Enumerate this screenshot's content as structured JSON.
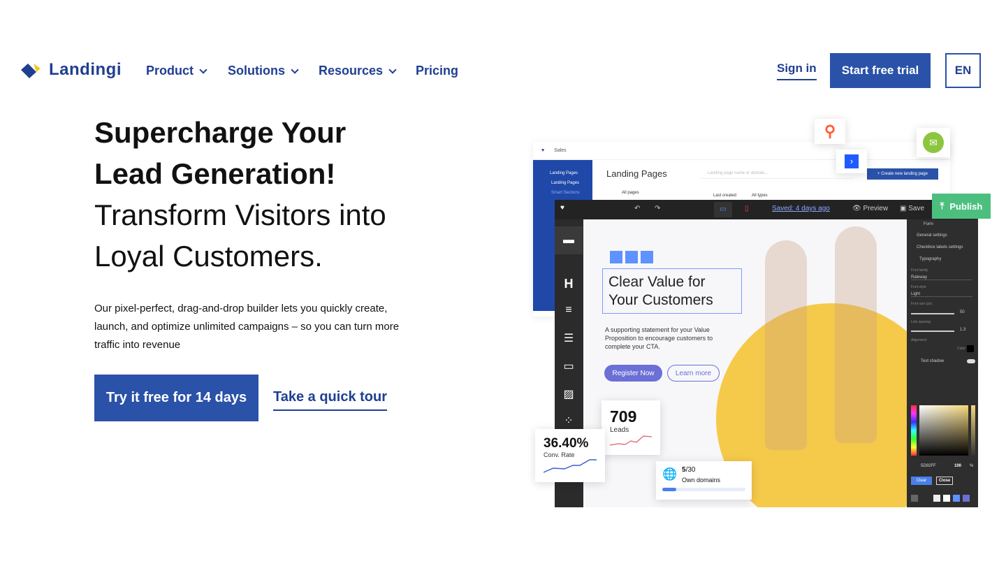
{
  "header": {
    "logo_text": "Landingi",
    "nav": [
      {
        "label": "Product"
      },
      {
        "label": "Solutions"
      },
      {
        "label": "Resources"
      },
      {
        "label": "Pricing"
      }
    ],
    "sign_in": "Sign in",
    "start_trial": "Start free trial",
    "language": "EN"
  },
  "hero": {
    "title_line1": "Supercharge Your",
    "title_line2": "Lead Generation!",
    "subtitle_line1": "Transform Visitors into",
    "subtitle_line2": "Loyal Customers.",
    "description": "Our pixel-perfect, drag-and-drop builder lets you quickly create, launch, and optimize unlimited campaigns – so you can turn more traffic into revenue",
    "cta_primary": "Try it free for 14 days",
    "cta_secondary": "Take a quick tour"
  },
  "mockup": {
    "dashboard": {
      "workspace": "Sales",
      "page_title": "Landing Pages",
      "search_placeholder": "Landing page name or domain...",
      "create_button": "+ Create new landing page",
      "sidebar": [
        "Landing Pages",
        "Landing Pages",
        "Smart Sections"
      ],
      "all_pages": "All pages",
      "sort": "Last created",
      "types": "All types"
    },
    "editor": {
      "saved": "Saved: 4 days ago",
      "preview": "Preview",
      "save": "Save",
      "publish": "Publish",
      "canvas_heading_1": "Clear Value for",
      "canvas_heading_2": "Your Customers",
      "canvas_text": "A supporting statement for your Value Proposition to encourage customers to complete your CTA.",
      "register": "Register Now",
      "learn_more": "Learn more"
    },
    "panel": {
      "title": "Form",
      "general": "General settings",
      "checkbox": "Checkbox labels settings",
      "typography": "Typography",
      "font_family_label": "Font family",
      "font_family": "Raleway",
      "font_style_label": "Font style",
      "font_style": "Light",
      "font_size_label": "Font size (px)",
      "font_size": "50",
      "line_spacing_label": "Line spacing",
      "line_spacing": "1.3",
      "alignment_label": "Alignment",
      "color_label": "Color",
      "text_shadow": "Text shadow",
      "hex": "5D92FF",
      "opacity": "100",
      "percent": "%",
      "clear": "Clear",
      "close": "Close"
    },
    "stats": {
      "leads_value": "709",
      "leads_label": "Leads",
      "conv_value": "36.40%",
      "conv_label": "Conv. Rate",
      "domains_used": "5",
      "domains_total": "/30",
      "domains_label": "Own domains",
      "domains_progress": 0.17
    }
  },
  "colors": {
    "brand": "#2a52a8",
    "nav": "#1f3f91",
    "publish": "#4cbf7f",
    "accent_yellow": "#f5c94a",
    "purple": "#6b6fd6"
  }
}
